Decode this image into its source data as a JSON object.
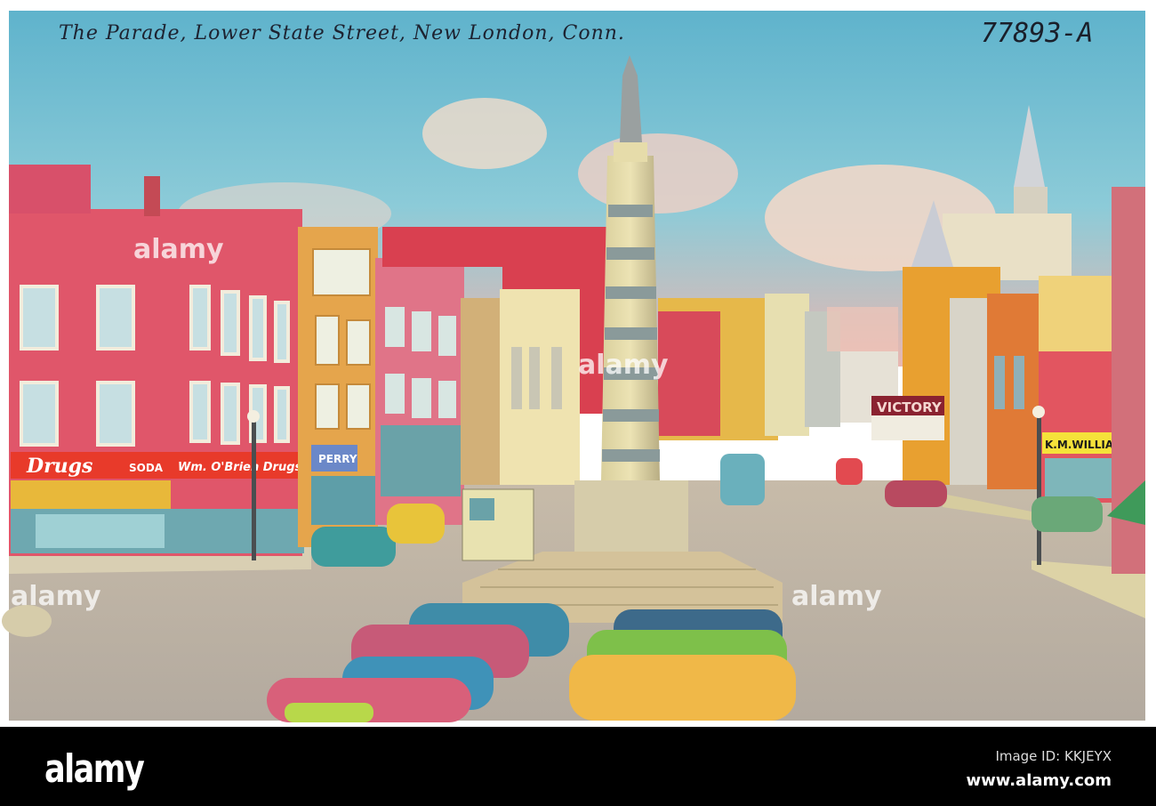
{
  "postcard": {
    "caption": "The Parade, Lower State Street, New London, Conn.",
    "catalog_number": "77893-A",
    "signs": {
      "drugs": "Drugs",
      "soda": "SODA",
      "drugstore_name": "Wm. O'Brien Drugs",
      "perry": "PERRY",
      "victory": "VICTORY",
      "williams": "K.M.WILLIAMS"
    }
  },
  "watermark": {
    "text": "alamy"
  },
  "footer": {
    "logo": "alamy",
    "image_id": "Image ID: KKJEYX",
    "url": "www.alamy.com"
  },
  "colors": {
    "sky_top": "#5fb3cc",
    "sky_low": "#e9b7b0",
    "street": "#b8aea0",
    "red_building": "#e0566a",
    "footer_bg": "#000000"
  }
}
